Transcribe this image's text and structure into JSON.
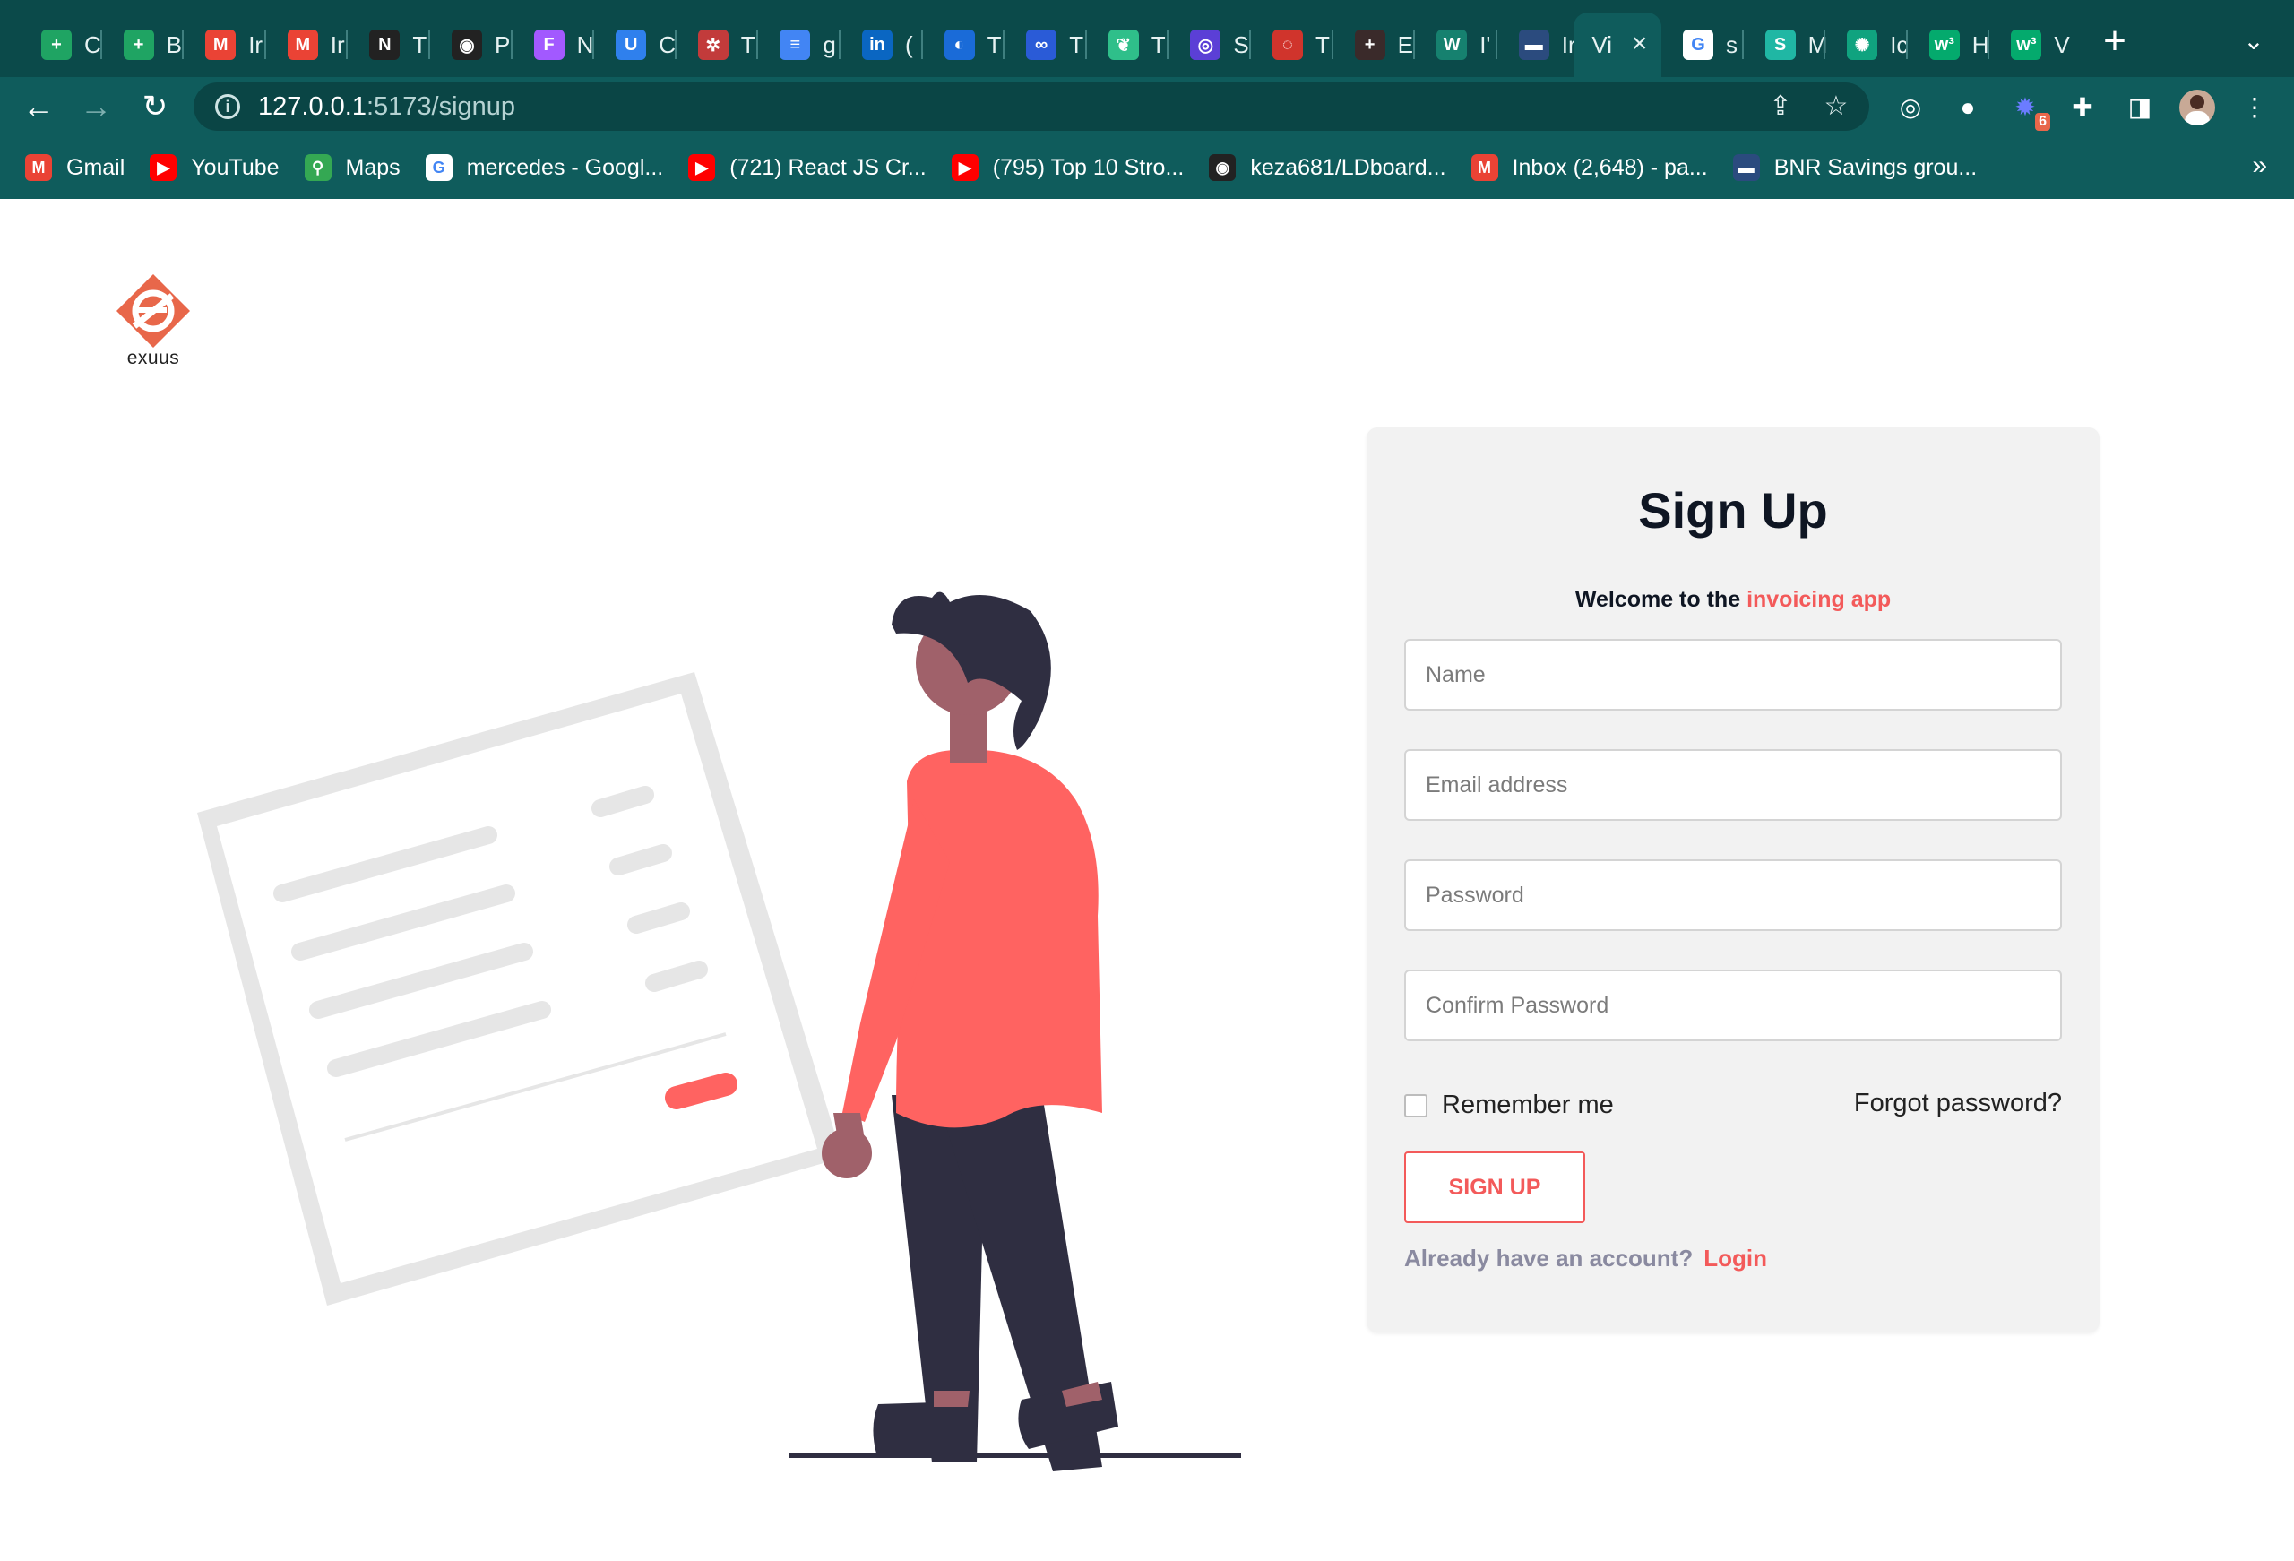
{
  "browser": {
    "tabs": [
      {
        "label": "C",
        "icon": "google-sheets-icon",
        "color": "#1fa463",
        "glyph": "+"
      },
      {
        "label": "B",
        "icon": "google-sheets-icon",
        "color": "#1fa463",
        "glyph": "+"
      },
      {
        "label": "Ir",
        "icon": "gmail-icon",
        "color": "#ea4335",
        "glyph": "M"
      },
      {
        "label": "Ir",
        "icon": "gmail-icon",
        "color": "#ea4335",
        "glyph": "M"
      },
      {
        "label": "T",
        "icon": "notion-icon",
        "color": "#222222",
        "glyph": "N"
      },
      {
        "label": "P",
        "icon": "github-icon",
        "color": "#222222",
        "glyph": "◉"
      },
      {
        "label": "N",
        "icon": "figma-icon",
        "color": "#a259ff",
        "glyph": "F"
      },
      {
        "label": "C",
        "icon": "webflow-icon",
        "color": "#2f80ed",
        "glyph": "U"
      },
      {
        "label": "T",
        "icon": "openai-red-icon",
        "color": "#c23b3b",
        "glyph": "✲"
      },
      {
        "label": "g",
        "icon": "google-docs-icon",
        "color": "#4285f4",
        "glyph": "≡"
      },
      {
        "label": "(",
        "icon": "linkedin-icon",
        "color": "#0a66c2",
        "glyph": "in"
      },
      {
        "label": "T",
        "icon": "app-blue-icon",
        "color": "#1a6bd8",
        "glyph": "◐"
      },
      {
        "label": "T",
        "icon": "app-dots-icon",
        "color": "#2a5bd7",
        "glyph": "∞"
      },
      {
        "label": "T",
        "icon": "leaf-icon",
        "color": "#2fbf8a",
        "glyph": "❦"
      },
      {
        "label": "S",
        "icon": "app-purple-icon",
        "color": "#5b3fd6",
        "glyph": "◎"
      },
      {
        "label": "T",
        "icon": "app-red-icon",
        "color": "#d0342c",
        "glyph": "◌"
      },
      {
        "label": "E",
        "icon": "plus-dark-icon",
        "color": "#3a2a2a",
        "glyph": "+"
      },
      {
        "label": "I'",
        "icon": "app-teal-icon",
        "color": "#16816f",
        "glyph": "W"
      },
      {
        "label": "Ir",
        "icon": "bnr-icon",
        "color": "#2b4b7e",
        "glyph": "▬"
      },
      {
        "label": "Vi",
        "icon": "",
        "color": "",
        "glyph": "",
        "active": true
      },
      {
        "label": "s",
        "icon": "google-icon",
        "color": "#ffffff",
        "glyph": "G"
      },
      {
        "label": "M",
        "icon": "app-s-icon",
        "color": "#20b7a4",
        "glyph": "S"
      },
      {
        "label": "Ic",
        "icon": "chatgpt-icon",
        "color": "#10a37f",
        "glyph": "✺"
      },
      {
        "label": "H",
        "icon": "w3schools-icon",
        "color": "#04aa6d",
        "glyph": "w³"
      },
      {
        "label": "V",
        "icon": "w3schools-icon",
        "color": "#04aa6d",
        "glyph": "w³"
      }
    ],
    "url_host": "127.0.0.1",
    "url_path": ":5173/signup",
    "extension_badge": "6",
    "bookmarks": [
      {
        "label": "Gmail",
        "icon": "gmail-icon",
        "color": "#ea4335",
        "glyph": "M"
      },
      {
        "label": "YouTube",
        "icon": "youtube-icon",
        "color": "#ff0000",
        "glyph": "▶"
      },
      {
        "label": "Maps",
        "icon": "maps-icon",
        "color": "#34a853",
        "glyph": "⚲"
      },
      {
        "label": "mercedes - Googl...",
        "icon": "google-icon",
        "color": "#ffffff",
        "glyph": "G"
      },
      {
        "label": "(721) React JS Cr...",
        "icon": "youtube-icon",
        "color": "#ff0000",
        "glyph": "▶"
      },
      {
        "label": "(795) Top 10 Stro...",
        "icon": "youtube-icon",
        "color": "#ff0000",
        "glyph": "▶"
      },
      {
        "label": "keza681/LDboard...",
        "icon": "github-icon",
        "color": "#222222",
        "glyph": "◉"
      },
      {
        "label": "Inbox (2,648) - pa...",
        "icon": "gmail-icon",
        "color": "#ea4335",
        "glyph": "M"
      },
      {
        "label": "BNR Savings grou...",
        "icon": "bnr-icon",
        "color": "#2b4b7e",
        "glyph": "▬"
      }
    ]
  },
  "page": {
    "logo_text": "exuus",
    "title": "Sign Up",
    "welcome_prefix": "Welcome to the ",
    "welcome_accent": "invoicing app",
    "fields": {
      "name_placeholder": "Name",
      "email_placeholder": "Email address",
      "password_placeholder": "Password",
      "confirm_placeholder": "Confirm Password"
    },
    "remember_label": "Remember me",
    "forgot_label": "Forgot password?",
    "signup_label": "SIGN UP",
    "have_account": "Already have an account?",
    "login_label": "Login"
  },
  "colors": {
    "chrome": "#0f5c5c",
    "accent": "#f35a5a",
    "logo": "#e8674a"
  }
}
